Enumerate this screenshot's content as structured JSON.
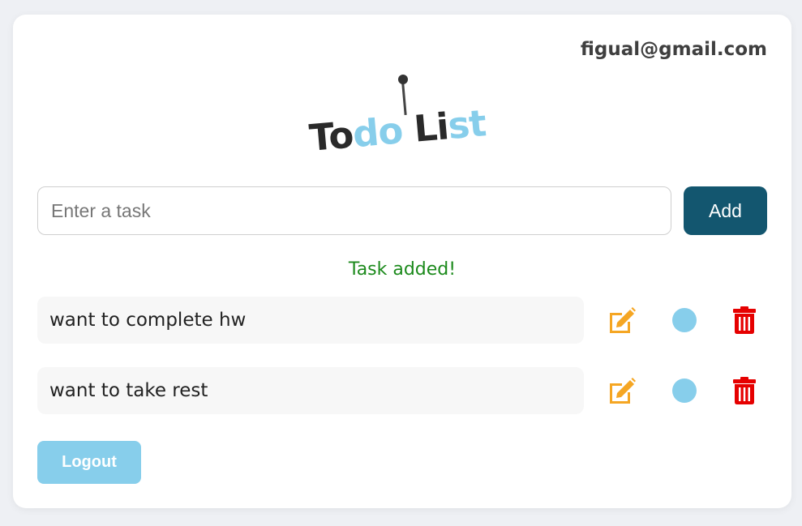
{
  "header": {
    "email": "figual@gmail.com"
  },
  "logo": {
    "parts": [
      "To",
      "do",
      " Li",
      "st"
    ]
  },
  "input": {
    "placeholder": "Enter a task",
    "value": ""
  },
  "add_button": {
    "label": "Add"
  },
  "status_message": "Task added!",
  "tasks": [
    {
      "text": "want to complete hw"
    },
    {
      "text": "want to take rest"
    }
  ],
  "icons": {
    "edit": "edit-icon",
    "complete": "circle-icon",
    "delete": "trash-icon"
  },
  "logout_button": {
    "label": "Logout"
  },
  "colors": {
    "accent_dark": "#13566f",
    "accent_light": "#87ceeb",
    "edit_icon": "#f5a623",
    "delete_icon": "#e60000",
    "status_text": "#1c8a1c"
  }
}
